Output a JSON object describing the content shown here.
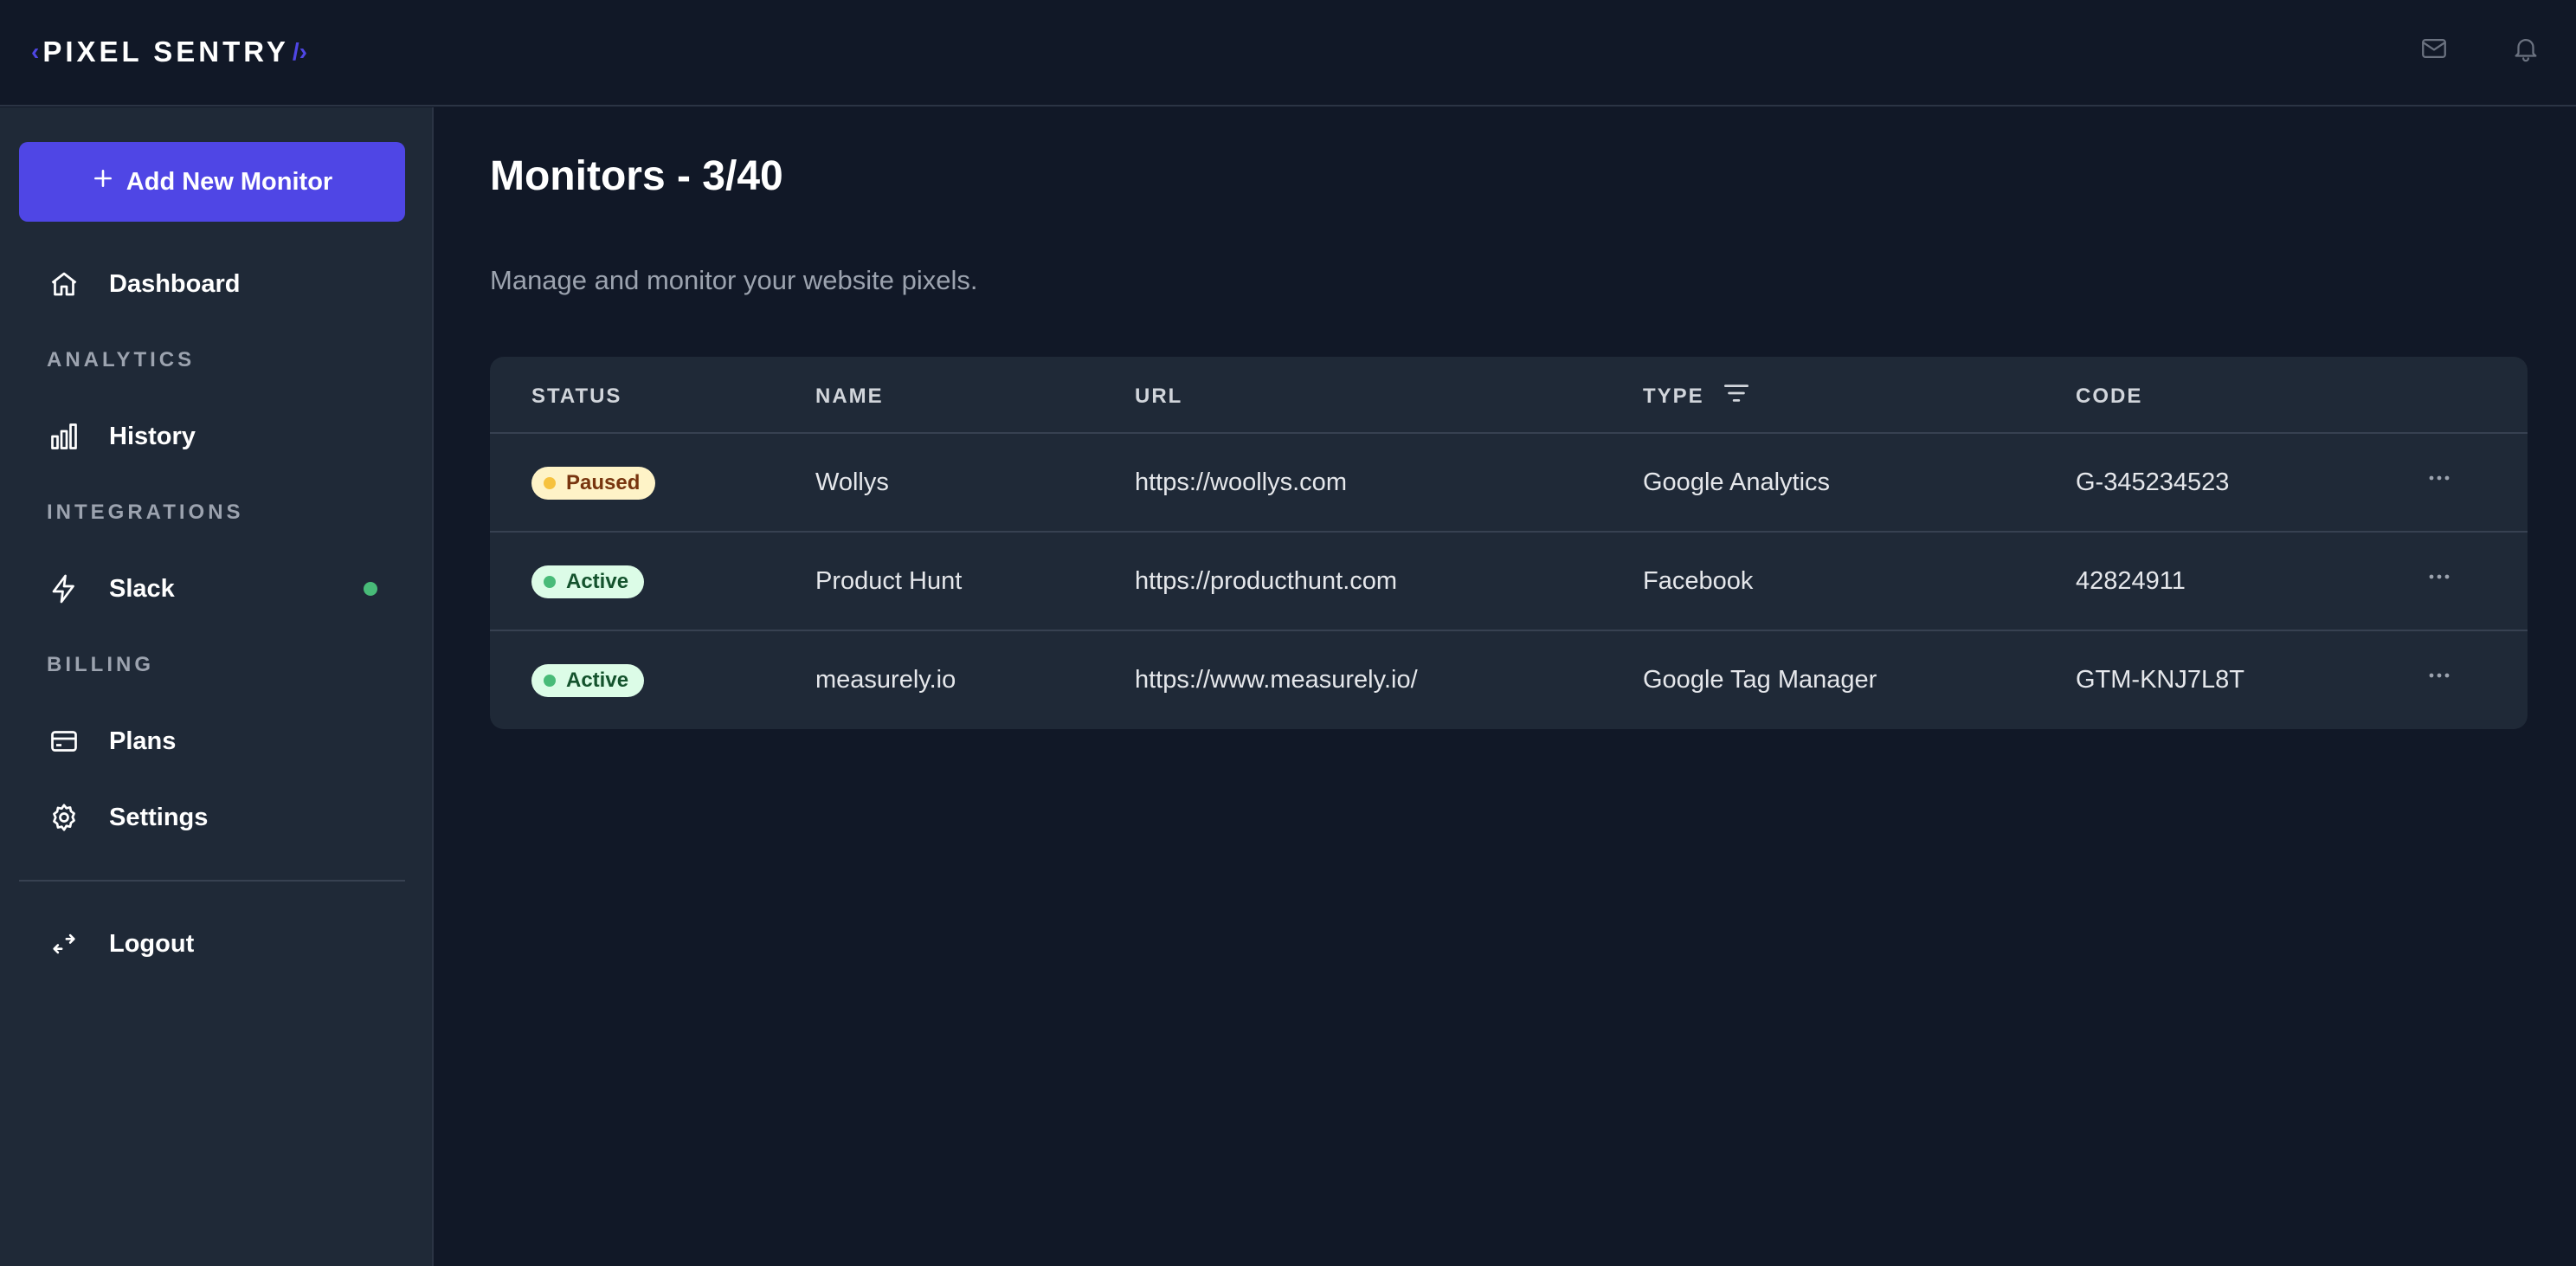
{
  "brand": {
    "left_bracket": "‹",
    "name": "PIXEL SENTRY",
    "right_bracket": "/›"
  },
  "header": {
    "icons": [
      "mail-icon",
      "bell-icon"
    ]
  },
  "sidebar": {
    "add_button_label": "Add New Monitor",
    "dashboard_label": "Dashboard",
    "analytics_section": "ANALYTICS",
    "history_label": "History",
    "integrations_section": "INTEGRATIONS",
    "slack_label": "Slack",
    "billing_section": "BILLING",
    "plans_label": "Plans",
    "settings_label": "Settings",
    "logout_label": "Logout"
  },
  "main": {
    "title": "Monitors - 3/40",
    "subtitle": "Manage and monitor your website pixels."
  },
  "table": {
    "headers": {
      "status": "STATUS",
      "name": "NAME",
      "url": "URL",
      "type": "TYPE",
      "code": "CODE"
    },
    "rows": [
      {
        "status": "Paused",
        "name": "Wollys",
        "url": "https://woollys.com",
        "type": "Google Analytics",
        "code": "G-345234523"
      },
      {
        "status": "Active",
        "name": "Product Hunt",
        "url": "https://producthunt.com",
        "type": "Facebook",
        "code": "42824911"
      },
      {
        "status": "Active",
        "name": "measurely.io",
        "url": "https://www.measurely.io/",
        "type": "Google Tag Manager",
        "code": "GTM-KNJ7L8T"
      }
    ]
  },
  "colors": {
    "background": "#111827",
    "sidebar": "#1f2937",
    "accent": "#4f46e5",
    "active": "#48bb78",
    "paused": "#f6c23e"
  }
}
